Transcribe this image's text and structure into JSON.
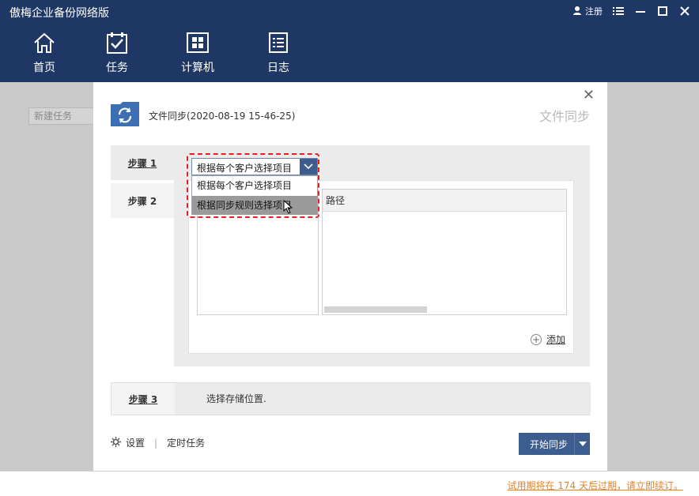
{
  "app": {
    "title": "傲梅企业备份网络版",
    "register_label": "注册"
  },
  "nav": {
    "items": [
      {
        "label": "首页",
        "icon": "home-icon"
      },
      {
        "label": "任务",
        "icon": "task-check-icon"
      },
      {
        "label": "计算机",
        "icon": "windows-computer-icon"
      },
      {
        "label": "日志",
        "icon": "log-list-icon"
      }
    ]
  },
  "background": {
    "new_task_label": "新建任务"
  },
  "dialog": {
    "subtitle": "文件同步(2020-08-19 15-46-25)",
    "title_right": "文件同步",
    "steps": [
      {
        "label": "步骤 1"
      },
      {
        "label": "步骤 2"
      },
      {
        "label": "步骤 3"
      }
    ],
    "step1": {
      "select_value": "根据每个客户选择项目",
      "options": [
        "根据每个客户选择项目",
        "根据同步规则选择项目"
      ],
      "selected_index": 1
    },
    "step2": {
      "path_header": "路径",
      "add_label": "添加"
    },
    "step3": {
      "description": "选择存储位置."
    },
    "footer": {
      "settings_label": "设置",
      "separator": "|",
      "schedule_label": "定时任务",
      "start_label": "开始同步"
    }
  },
  "status": {
    "trial_text": "试用期将在 174 天后过期，请立即续订。"
  },
  "colors": {
    "topbar": "#1f3764",
    "accent": "#3c5d8e",
    "highlight_border": "#e52020",
    "trial_text": "#e5832a"
  }
}
